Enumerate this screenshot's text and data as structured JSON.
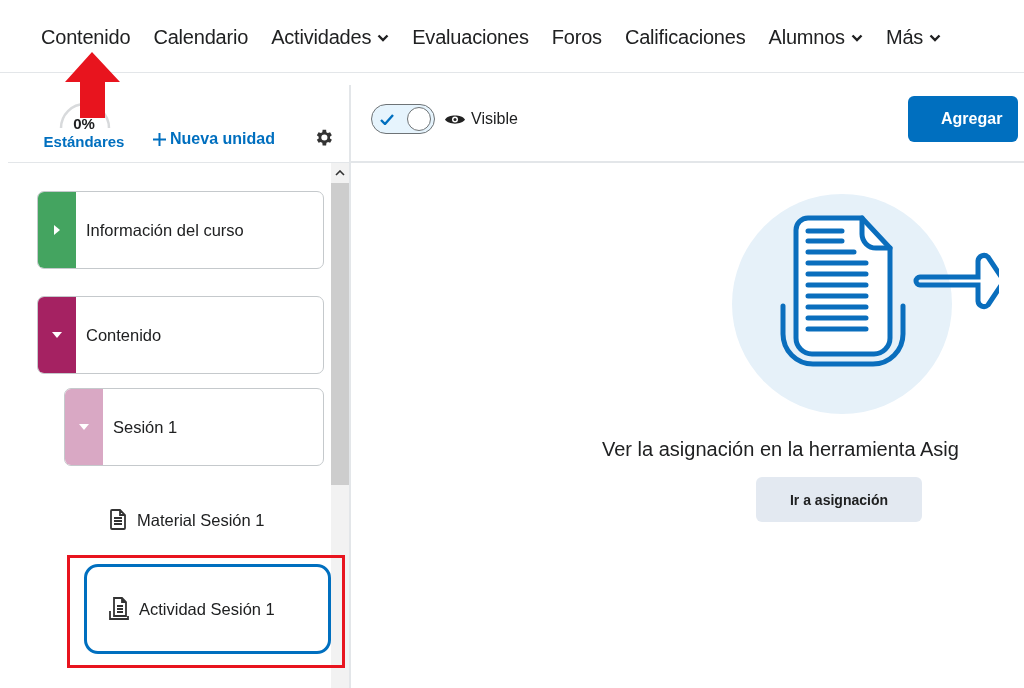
{
  "nav": {
    "items": [
      {
        "label": "Contenido",
        "dropdown": false
      },
      {
        "label": "Calendario",
        "dropdown": false
      },
      {
        "label": "Actividades",
        "dropdown": true
      },
      {
        "label": "Evaluaciones",
        "dropdown": false
      },
      {
        "label": "Foros",
        "dropdown": false
      },
      {
        "label": "Calificaciones",
        "dropdown": false
      },
      {
        "label": "Alumnos",
        "dropdown": true
      },
      {
        "label": "Más",
        "dropdown": true
      }
    ]
  },
  "sidebar": {
    "progress": {
      "value": "0%",
      "label": "Estándares"
    },
    "new_unit": "Nueva unidad",
    "tree": [
      {
        "kind": "unit",
        "title": "Información del curso",
        "color": "#44a460",
        "expanded": false
      },
      {
        "kind": "unit",
        "title": "Contenido",
        "color": "#a52262",
        "expanded": true,
        "children": [
          {
            "kind": "unit",
            "title": "Sesión 1",
            "color": "#d9a8c4",
            "expanded": true,
            "children": [
              {
                "kind": "topic",
                "title": "Material Sesión 1",
                "selected": false
              },
              {
                "kind": "topic",
                "title": "Actividad Sesión 1",
                "selected": true
              }
            ]
          }
        ]
      }
    ]
  },
  "toolbar": {
    "visibility_toggle": {
      "on": true
    },
    "visibility_label": "Visible",
    "add_button": "Agregar"
  },
  "main": {
    "message": "Ver la asignación en la herramienta Asig",
    "button": "Ir a asignación"
  }
}
